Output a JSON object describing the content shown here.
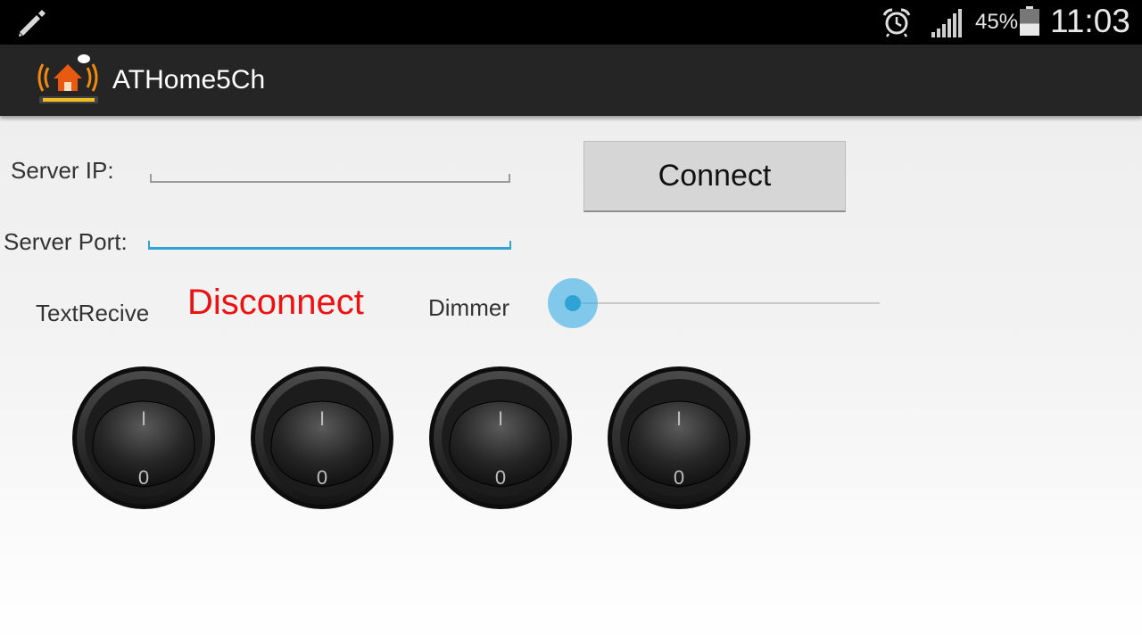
{
  "status_bar": {
    "battery_percent": "45%",
    "battery_level": 0.45,
    "time": "11:03",
    "icons": [
      "edit-icon",
      "alarm-icon",
      "signal-icon",
      "battery-icon"
    ]
  },
  "action_bar": {
    "title": "ATHome5Ch",
    "logo_icon": "home-wifi-logo"
  },
  "form": {
    "server_ip_label": "Server IP:",
    "server_ip_value": "",
    "server_port_label": "Server Port:",
    "server_port_value": "",
    "connect_label": "Connect"
  },
  "status": {
    "receive_label": "TextRecive",
    "connection_text": "Disconnect",
    "connection_color": "#ee1111"
  },
  "dimmer": {
    "label": "Dimmer",
    "value": 0
  },
  "switches": [
    {
      "on_label": "I",
      "off_label": "0",
      "state": "off"
    },
    {
      "on_label": "I",
      "off_label": "0",
      "state": "off"
    },
    {
      "on_label": "I",
      "off_label": "0",
      "state": "off"
    },
    {
      "on_label": "I",
      "off_label": "0",
      "state": "off"
    }
  ],
  "colors": {
    "accent": "#2fa3d6",
    "action_bar": "#252525",
    "status_bar": "#000000"
  }
}
